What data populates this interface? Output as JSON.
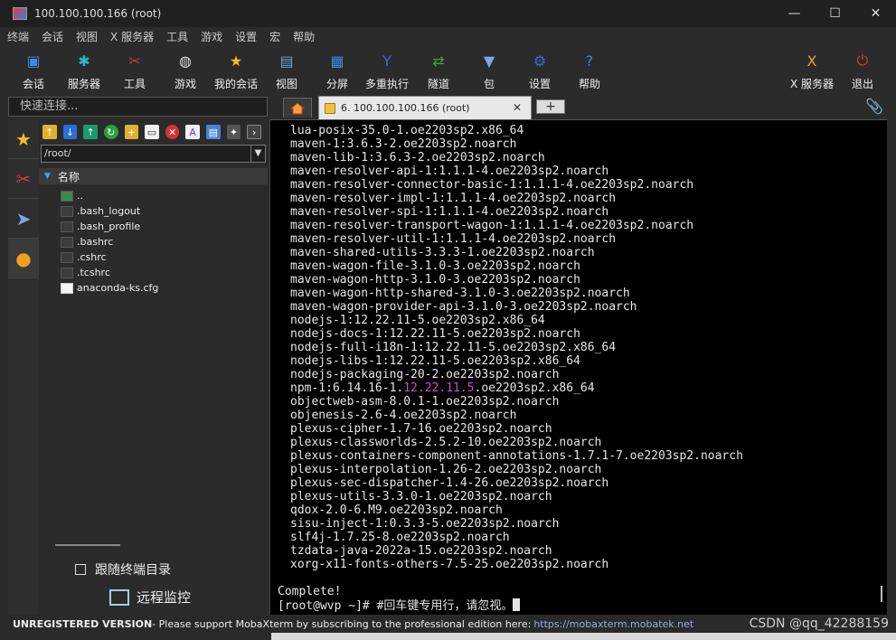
{
  "window": {
    "title": "100.100.100.166 (root)",
    "min": "—",
    "max": "☐",
    "close": "✕"
  },
  "menu": [
    "终端",
    "会话",
    "视图",
    "X 服务器",
    "工具",
    "游戏",
    "设置",
    "宏",
    "帮助"
  ],
  "toolbar": [
    {
      "label": "会话",
      "icon": "session-icon",
      "color": "#3a8ee6"
    },
    {
      "label": "服务器",
      "icon": "servers-icon",
      "color": "#2fb7c9"
    },
    {
      "label": "工具",
      "icon": "tools-icon",
      "color": "#c83a3a"
    },
    {
      "label": "游戏",
      "icon": "gamepad-icon",
      "color": "#dddddd"
    },
    {
      "label": "我的会话",
      "icon": "star-icon",
      "color": "#f2c21b"
    },
    {
      "label": "视图",
      "icon": "view-icon",
      "color": "#6a9fd8"
    },
    {
      "label": "分屏",
      "icon": "split-icon",
      "color": "#3a8ee6"
    },
    {
      "label": "多重执行",
      "icon": "fork-icon",
      "color": "#3a6cd8"
    },
    {
      "label": "隧道",
      "icon": "tunnel-icon",
      "color": "#39a14a"
    },
    {
      "label": "包",
      "icon": "package-icon",
      "color": "#7aa7e6"
    },
    {
      "label": "设置",
      "icon": "gears-icon",
      "color": "#3a6cd8"
    },
    {
      "label": "帮助",
      "icon": "help-icon",
      "color": "#2a86e6"
    },
    {
      "label": "X 服务器",
      "icon": "x-server-icon",
      "color": "#e6a23a"
    },
    {
      "label": "退出",
      "icon": "power-icon",
      "color": "#e03a3a"
    }
  ],
  "quick_connect": {
    "placeholder": "快速连接..."
  },
  "tabs": {
    "active_label": "6. 100.100.100.166 (root)",
    "close": "✕",
    "add": "+"
  },
  "sftp": {
    "path": "/root/",
    "column": "名称",
    "files": [
      "..",
      ".bash_logout",
      ".bash_profile",
      ".bashrc",
      ".cshrc",
      ".tcshrc",
      "anaconda-ks.cfg"
    ],
    "follow_label": "跟随终端目录",
    "monitor_label": "远程监控"
  },
  "terminal": {
    "lines": [
      "lua-posix-35.0-1.oe2203sp2.x86_64",
      "maven-1:3.6.3-2.oe2203sp2.noarch",
      "maven-lib-1:3.6.3-2.oe2203sp2.noarch",
      "maven-resolver-api-1:1.1.1-4.oe2203sp2.noarch",
      "maven-resolver-connector-basic-1:1.1.1-4.oe2203sp2.noarch",
      "maven-resolver-impl-1:1.1.1-4.oe2203sp2.noarch",
      "maven-resolver-spi-1:1.1.1-4.oe2203sp2.noarch",
      "maven-resolver-transport-wagon-1:1.1.1-4.oe2203sp2.noarch",
      "maven-resolver-util-1:1.1.1-4.oe2203sp2.noarch",
      "maven-shared-utils-3.3.3-1.oe2203sp2.noarch",
      "maven-wagon-file-3.1.0-3.oe2203sp2.noarch",
      "maven-wagon-http-3.1.0-3.oe2203sp2.noarch",
      "maven-wagon-http-shared-3.1.0-3.oe2203sp2.noarch",
      "maven-wagon-provider-api-3.1.0-3.oe2203sp2.noarch",
      "nodejs-1:12.22.11-5.oe2203sp2.x86_64",
      "nodejs-docs-1:12.22.11-5.oe2203sp2.noarch",
      "nodejs-full-i18n-1:12.22.11-5.oe2203sp2.x86_64",
      "nodejs-libs-1:12.22.11-5.oe2203sp2.x86_64",
      "nodejs-packaging-20-2.oe2203sp2.noarch",
      "NPM_LINE",
      "objectweb-asm-8.0.1-1.oe2203sp2.noarch",
      "objenesis-2.6-4.oe2203sp2.noarch",
      "plexus-cipher-1.7-16.oe2203sp2.noarch",
      "plexus-classworlds-2.5.2-10.oe2203sp2.noarch",
      "plexus-containers-component-annotations-1.7.1-7.oe2203sp2.noarch",
      "plexus-interpolation-1.26-2.oe2203sp2.noarch",
      "plexus-sec-dispatcher-1.4-26.oe2203sp2.noarch",
      "plexus-utils-3.3.0-1.oe2203sp2.noarch",
      "qdox-2.0-6.M9.oe2203sp2.noarch",
      "sisu-inject-1:0.3.3-5.oe2203sp2.noarch",
      "slf4j-1.7.25-8.oe2203sp2.noarch",
      "tzdata-java-2022a-15.oe2203sp2.noarch",
      "xorg-x11-fonts-others-7.5-25.oe2203sp2.noarch"
    ],
    "npm_pre": "npm-1:6.14.16-1.",
    "npm_hl": "12.22.11.5",
    "npm_post": ".oe2203sp2.x86_64",
    "complete": "Complete!",
    "prompt": "[root@wvp ~]# #回车键专用行，请忽视。"
  },
  "status": {
    "unregistered": "UNREGISTERED VERSION",
    "message": " -  Please support MobaXterm by subscribing to the professional edition here: ",
    "url": "https://mobaxterm.mobatek.net"
  },
  "watermark": "CSDN @qq_42288159"
}
